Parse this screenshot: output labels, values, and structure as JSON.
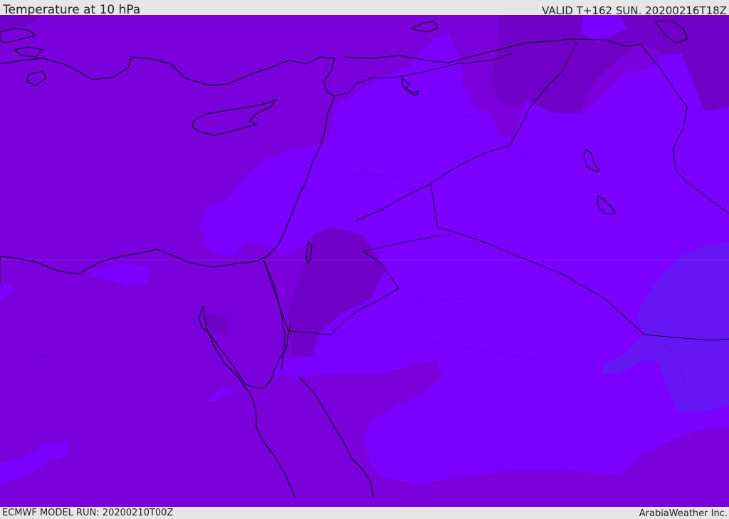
{
  "header": {
    "title": "Temperature at 10 hPa",
    "valid_time": "VALID T+162 SUN. 20200216T18Z"
  },
  "footer": {
    "model_run": "ECMWF MODEL RUN: 20200210T00Z",
    "credit": "ArabiaWeather Inc."
  },
  "map": {
    "colors": {
      "base": "#7a00dc",
      "warm": "#7000c8",
      "cold": "#7c00ff",
      "colder": "#6616f2",
      "coastline": "#000000"
    }
  }
}
